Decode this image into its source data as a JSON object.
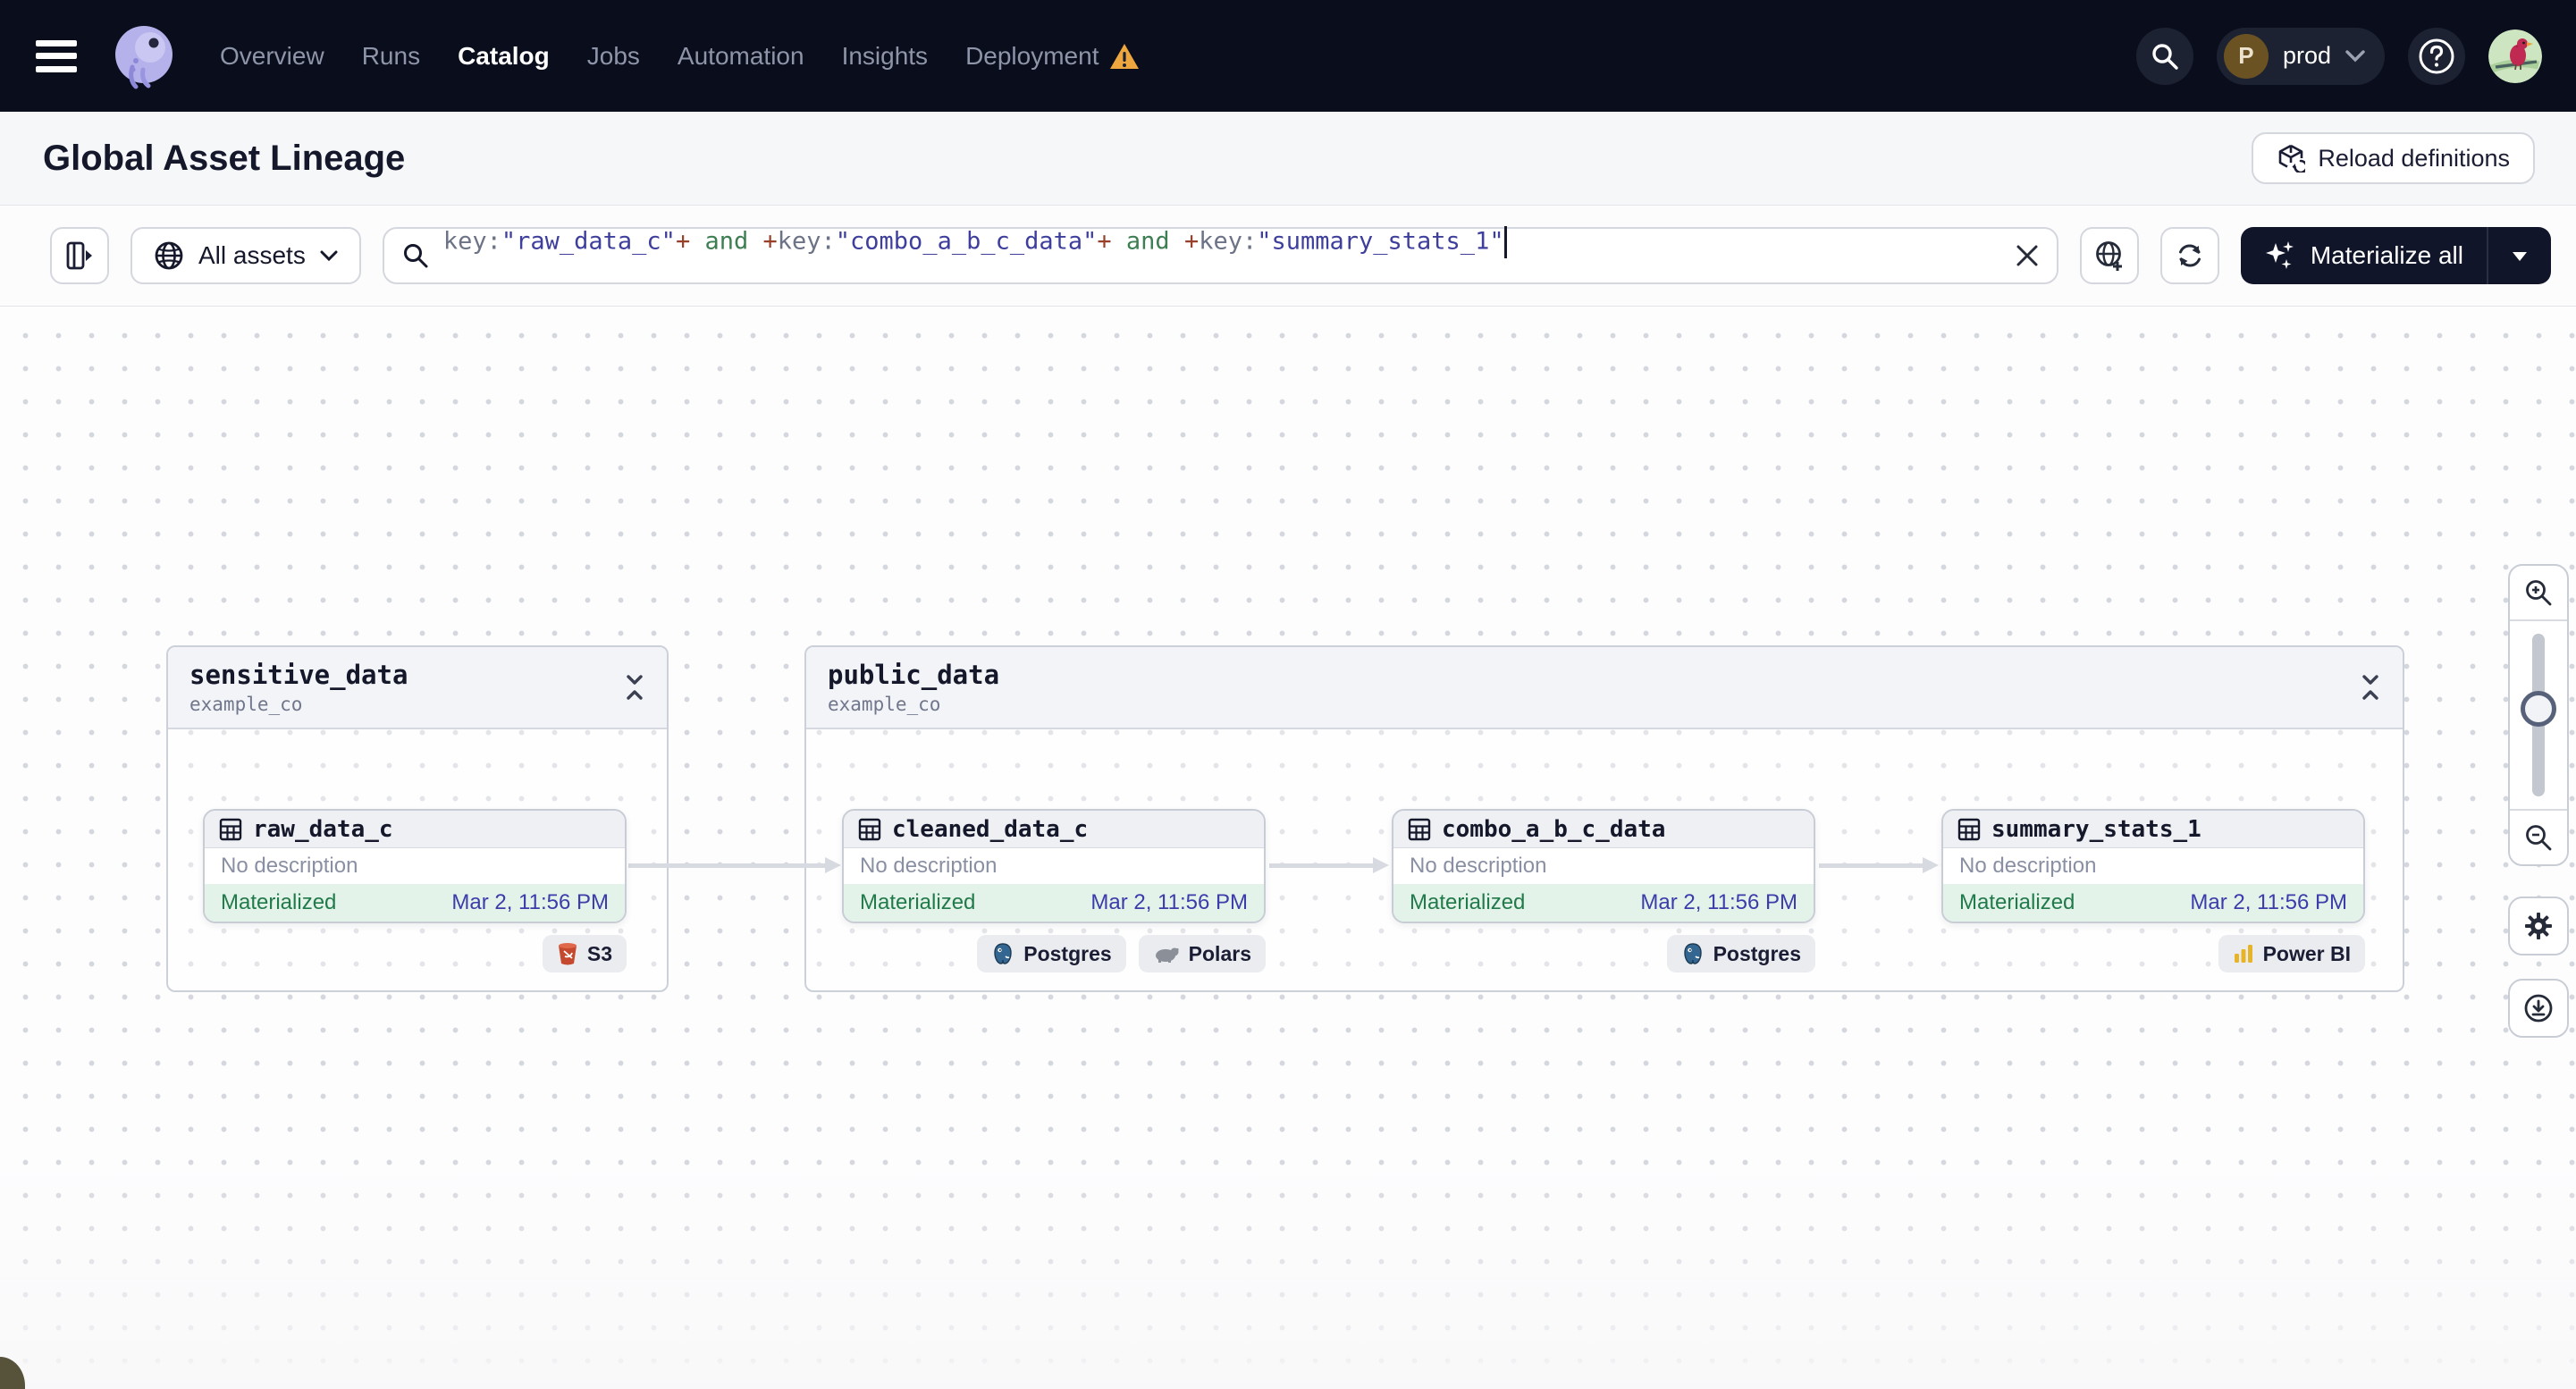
{
  "navbar": {
    "items": [
      {
        "label": "Overview",
        "active": false
      },
      {
        "label": "Runs",
        "active": false
      },
      {
        "label": "Catalog",
        "active": true
      },
      {
        "label": "Jobs",
        "active": false
      },
      {
        "label": "Automation",
        "active": false
      },
      {
        "label": "Insights",
        "active": false
      },
      {
        "label": "Deployment",
        "active": false,
        "warning": true
      }
    ],
    "environment": {
      "initial": "P",
      "name": "prod"
    }
  },
  "header": {
    "title": "Global Asset Lineage",
    "reload_button": "Reload definitions"
  },
  "filter": {
    "scope_label": "All assets",
    "query_tokens": [
      {
        "text": "key:",
        "type": "key"
      },
      {
        "text": "\"raw_data_c\"",
        "type": "string"
      },
      {
        "text": "+",
        "type": "op"
      },
      {
        "text": " and ",
        "type": "and"
      },
      {
        "text": "+",
        "type": "op"
      },
      {
        "text": "key:",
        "type": "key"
      },
      {
        "text": "\"combo_a_b_c_data\"",
        "type": "string"
      },
      {
        "text": "+",
        "type": "op"
      },
      {
        "text": " and ",
        "type": "and"
      },
      {
        "text": "+",
        "type": "op"
      },
      {
        "text": "key:",
        "type": "key"
      },
      {
        "text": "\"summary_stats_1\"",
        "type": "string"
      }
    ],
    "materialize_label": "Materialize all"
  },
  "canvas": {
    "groups": [
      {
        "name": "sensitive_data",
        "location": "example_co",
        "assets": [
          {
            "name": "raw_data_c",
            "description": "No description",
            "status": "Materialized",
            "timestamp": "Mar 2, 11:56 PM",
            "badges": [
              {
                "label": "S3",
                "icon": "s3-bucket-icon"
              }
            ]
          }
        ]
      },
      {
        "name": "public_data",
        "location": "example_co",
        "assets": [
          {
            "name": "cleaned_data_c",
            "description": "No description",
            "status": "Materialized",
            "timestamp": "Mar 2, 11:56 PM",
            "badges": [
              {
                "label": "Postgres",
                "icon": "postgres-icon"
              },
              {
                "label": "Polars",
                "icon": "polars-icon"
              }
            ]
          },
          {
            "name": "combo_a_b_c_data",
            "description": "No description",
            "status": "Materialized",
            "timestamp": "Mar 2, 11:56 PM",
            "badges": [
              {
                "label": "Postgres",
                "icon": "postgres-icon"
              }
            ]
          },
          {
            "name": "summary_stats_1",
            "description": "No description",
            "status": "Materialized",
            "timestamp": "Mar 2, 11:56 PM",
            "badges": [
              {
                "label": "Power BI",
                "icon": "powerbi-icon"
              }
            ]
          }
        ]
      }
    ]
  },
  "colors": {
    "navbar_bg": "#0a0d1c",
    "accent_dark_button": "#11152a",
    "materialized_green": "#217a4a",
    "timestamp_indigo": "#3c3caa",
    "warning_amber": "#eea63f",
    "query_string": "#3e3e9c",
    "query_operator": "#99402b",
    "query_and": "#3d7e52"
  }
}
